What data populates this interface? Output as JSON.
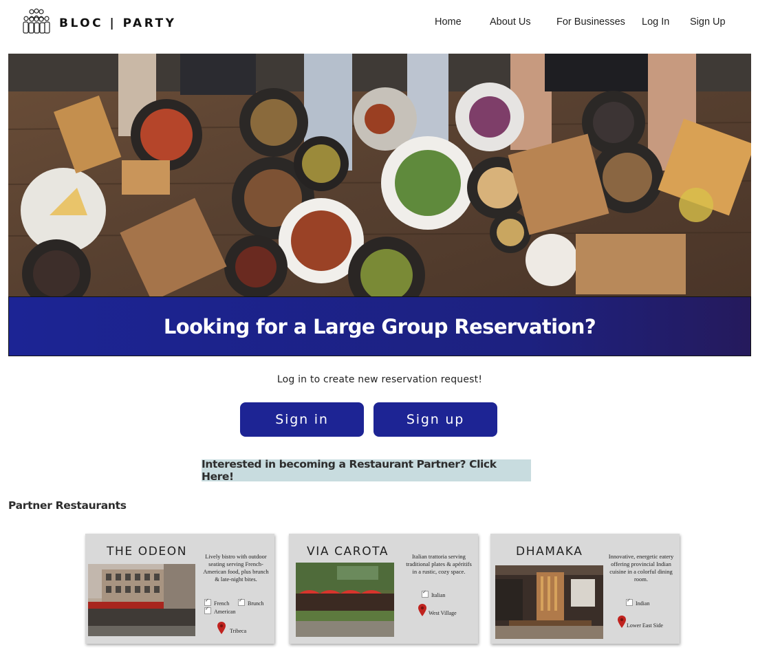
{
  "brand": {
    "name": "BLOC | PARTY",
    "logo_icon": "group-people-icon"
  },
  "nav": {
    "home": "Home",
    "about": "About Us",
    "business": "For Businesses",
    "login": "Log In",
    "signup": "Sign Up"
  },
  "hero": {
    "image_icon": "food-table-photo",
    "title": "Looking for a Large Group Reservation?"
  },
  "cta": {
    "prompt": "Log in to create new reservation request!",
    "signin_label": "Sign in",
    "signup_label": "Sign up",
    "partner_label": "Interested in becoming a Restaurant Partner? Click Here!"
  },
  "restaurants": {
    "section_title": "Partner Restaurants",
    "items": [
      {
        "name": "THE ODEON",
        "description": "Lively bistro with outdoor seating serving French-American food, plus brunch & late-night bites.",
        "tags": [
          "French",
          "Brunch",
          "American"
        ],
        "location": "Tribeca"
      },
      {
        "name": "VIA CAROTA",
        "description": "Italian trattoria serving traditional plates & apéritifs in a rustic, cozy space.",
        "tags": [
          "Italian"
        ],
        "location": "West Village"
      },
      {
        "name": "DHAMAKA",
        "description": "Innovative, energetic eatery offering provincial Indian cuisine in a colorful dining room.",
        "tags": [
          "Indian"
        ],
        "location": "Lower East Side"
      }
    ]
  },
  "colors": {
    "primary": "#1d2494",
    "banner_end": "#251a5c",
    "partner_bg": "#c8dcdf",
    "card_bg": "#d9d9d9",
    "pin": "#c0231f"
  }
}
